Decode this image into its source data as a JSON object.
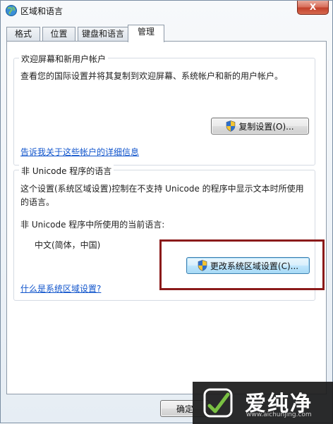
{
  "window": {
    "title": "区域和语言",
    "close_label": "X"
  },
  "tabs": [
    {
      "label": "格式"
    },
    {
      "label": "位置"
    },
    {
      "label": "键盘和语言"
    },
    {
      "label": "管理",
      "active": true
    }
  ],
  "welcome_group": {
    "legend": "欢迎屏幕和新用户帐户",
    "description": "查看您的国际设置并将其复制到欢迎屏幕、系统帐户和新的用户帐户。",
    "copy_button_label": "复制设置(O)...",
    "details_link": "告诉我关于这些帐户的详细信息"
  },
  "unicode_group": {
    "legend": "非 Unicode 程序的语言",
    "description": "这个设置(系统区域设置)控制在不支持 Unicode 的程序中显示文本时所使用的语言。",
    "current_language_label": "非 Unicode 程序中所使用的当前语言:",
    "current_language_value": "中文(简体，中国)",
    "change_button_label": "更改系统区域设置(C)...",
    "what_is_link": "什么是系统区域设置?"
  },
  "footer": {
    "ok_label": "确定"
  },
  "watermark": {
    "brand": "爱纯净",
    "url": "www.aichunjing.com"
  },
  "colors": {
    "highlight_border": "#8b1a1a",
    "link": "#1155cc"
  }
}
